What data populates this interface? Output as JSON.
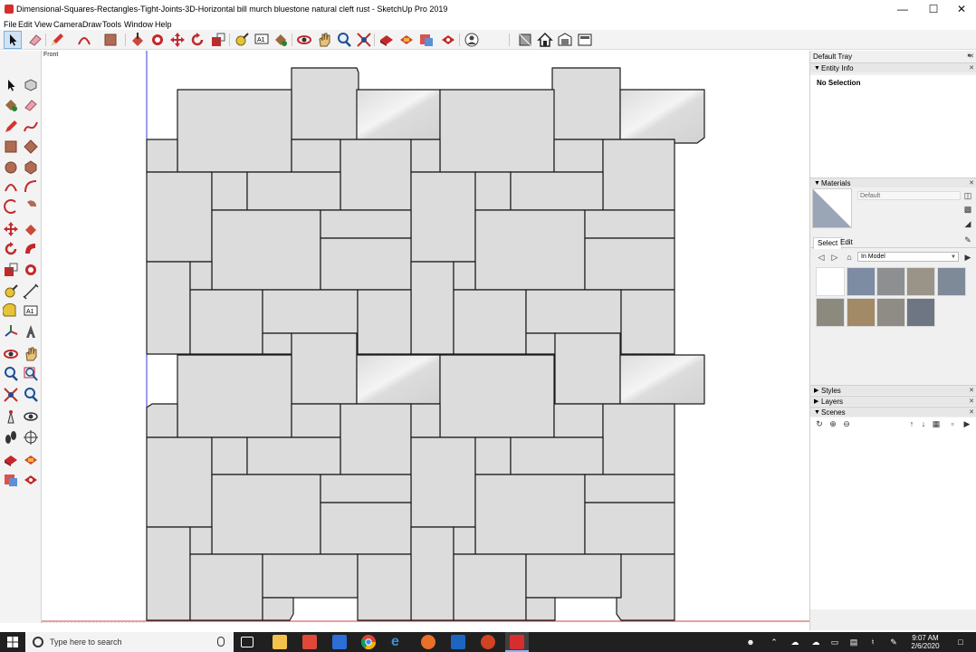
{
  "window": {
    "title": "Dimensional-Squares-Rectangles-Tight-Joints-3D-Horizontal bill murch bluestone natural cleft rust - SketchUp Pro 2019",
    "minimize": "—",
    "maximize": "☐",
    "close": "✕"
  },
  "menu": [
    "File",
    "Edit",
    "View",
    "Camera",
    "Draw",
    "Tools",
    "Window",
    "Help"
  ],
  "toolbar": {
    "tools": [
      "select-icon",
      "eraser-icon",
      "pencil-icon",
      "arc-icon",
      "rectangle-icon",
      "push-pull-icon",
      "offset-icon",
      "move-icon",
      "rotate-icon",
      "scale-icon",
      "tape-measure-icon",
      "text-icon",
      "paint-bucket-icon",
      "orbit-icon",
      "pan-icon",
      "zoom-icon",
      "zoom-extents-icon",
      "3d-warehouse-icon",
      "extension-warehouse-icon",
      "send-to-layout-icon",
      "extension-manager-icon",
      "profile-icon",
      "section-plane-icon",
      "home-view-icon",
      "front-view-icon",
      "top-view-icon"
    ]
  },
  "left_toolbar": {
    "tools": [
      "select-icon",
      "make-component-icon",
      "paint-bucket-icon",
      "eraser-icon",
      "line-icon",
      "freehand-icon",
      "rectangle-icon",
      "rotated-rectangle-icon",
      "circle-icon",
      "polygon-icon",
      "arc-icon",
      "two-point-arc-icon",
      "three-point-arc-icon",
      "pie-icon",
      "move-icon",
      "push-pull-icon",
      "rotate-icon",
      "follow-me-icon",
      "scale-icon",
      "offset-icon",
      "tape-measure-icon",
      "dimension-icon",
      "protractor-icon",
      "text-icon",
      "axes-icon",
      "3d-text-icon",
      "orbit-icon",
      "pan-icon",
      "zoom-icon",
      "zoom-window-icon",
      "zoom-extents-icon",
      "previous-view-icon",
      "position-camera-icon",
      "look-around-icon",
      "walk-icon",
      "section-plane-icon",
      "warehouse-icon",
      "extension-icon",
      "send-to-layout-icon",
      "extension-manager-icon"
    ]
  },
  "viewport": {
    "scene_label": "Front"
  },
  "tray": {
    "title": "Default Tray",
    "entity_info": {
      "title": "Entity Info",
      "selection": "No Selection"
    },
    "materials": {
      "title": "Materials",
      "current_name": "Default",
      "tabs": [
        "Select",
        "Edit"
      ],
      "collection": "In Model",
      "swatch_colors": [
        "#ffffff",
        "#7d8ba3",
        "#8d8f90",
        "#9a9488",
        "#7f8a99",
        "#8c8a7e",
        "#a38a66",
        "#8f8c85",
        "#6e7684"
      ]
    },
    "styles": {
      "title": "Styles"
    },
    "layers": {
      "title": "Layers"
    },
    "scenes": {
      "title": "Scenes"
    }
  },
  "taskbar": {
    "search_placeholder": "Type here to search",
    "time": "9:07 AM",
    "date": "2/6/2020",
    "apps": [
      "task-view-icon",
      "file-explorer-icon",
      "sketchup-layout-icon",
      "style-builder-icon",
      "chrome-icon",
      "edge-icon",
      "firefox-icon",
      "outlook-icon",
      "powerpoint-icon",
      "sketchup-icon"
    ]
  },
  "colors": {
    "paver_fill": "#dcdcdc",
    "paver_stroke": "#1a1a1a",
    "accent_red": "#d62e2e"
  }
}
